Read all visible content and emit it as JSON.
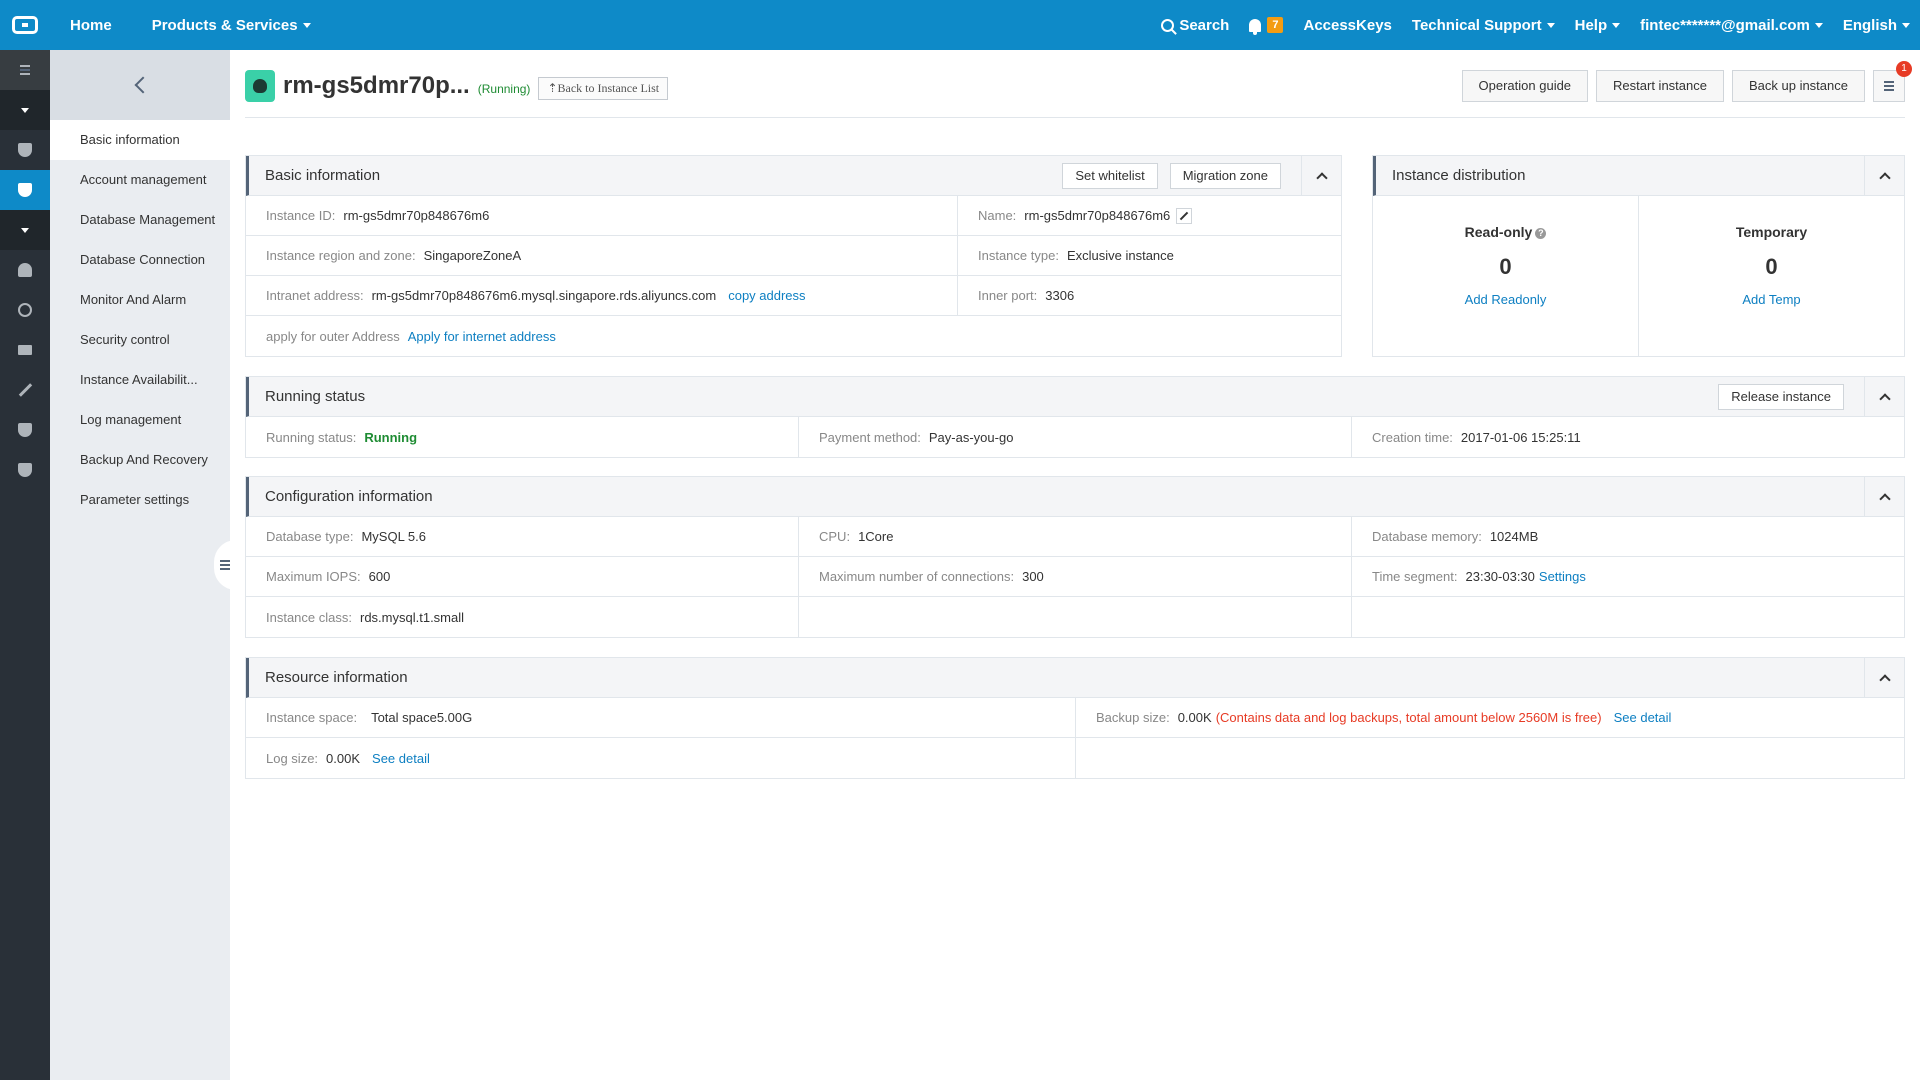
{
  "topbar": {
    "home": "Home",
    "products": "Products & Services",
    "search": "Search",
    "notifications_count": "7",
    "access_keys": "AccessKeys",
    "tech_support": "Technical Support",
    "help": "Help",
    "account": "fintec*******@gmail.com",
    "language": "English"
  },
  "sidebar": {
    "items": [
      {
        "label": "Basic information"
      },
      {
        "label": "Account management"
      },
      {
        "label": "Database Management"
      },
      {
        "label": "Database Connection"
      },
      {
        "label": "Monitor And Alarm"
      },
      {
        "label": "Security control"
      },
      {
        "label": "Instance Availabilit..."
      },
      {
        "label": "Log management"
      },
      {
        "label": "Backup And Recovery"
      },
      {
        "label": "Parameter settings"
      }
    ]
  },
  "header": {
    "title": "rm-gs5dmr70p...",
    "status": "(Running)",
    "back_link": "⇡Back to Instance List",
    "buttons": {
      "operation_guide": "Operation guide",
      "restart": "Restart instance",
      "backup": "Back up instance"
    },
    "list_badge": "1"
  },
  "basic": {
    "title": "Basic information",
    "set_whitelist": "Set whitelist",
    "migration_zone": "Migration zone",
    "instance_id_label": "Instance ID:",
    "instance_id": "rm-gs5dmr70p848676m6",
    "name_label": "Name:",
    "name": "rm-gs5dmr70p848676m6",
    "region_label": "Instance region and zone:",
    "region": "SingaporeZoneA",
    "type_label": "Instance type:",
    "type": "Exclusive instance",
    "intranet_label": "Intranet address:",
    "intranet": "rm-gs5dmr70p848676m6.mysql.singapore.rds.aliyuncs.com",
    "copy_address": "copy address",
    "port_label": "Inner port:",
    "port": "3306",
    "outer_label": "apply for outer Address",
    "outer_link": "Apply for internet address"
  },
  "distribution": {
    "title": "Instance distribution",
    "readonly_label": "Read-only",
    "readonly_count": "0",
    "readonly_link": "Add Readonly",
    "temp_label": "Temporary",
    "temp_count": "0",
    "temp_link": "Add Temp"
  },
  "running": {
    "title": "Running status",
    "release": "Release instance",
    "status_label": "Running status:",
    "status": "Running",
    "payment_label": "Payment method:",
    "payment": "Pay-as-you-go",
    "created_label": "Creation time:",
    "created": "2017-01-06 15:25:11"
  },
  "config": {
    "title": "Configuration information",
    "db_type_label": "Database type:",
    "db_type": "MySQL 5.6",
    "cpu_label": "CPU:",
    "cpu": "1Core",
    "memory_label": "Database memory:",
    "memory": "1024MB",
    "iops_label": "Maximum IOPS:",
    "iops": "600",
    "conn_label": "Maximum number of connections:",
    "conn": "300",
    "time_label": "Time segment:",
    "time": "23:30-03:30",
    "settings_link": "Settings",
    "class_label": "Instance class:",
    "class": "rds.mysql.t1.small"
  },
  "resource": {
    "title": "Resource information",
    "space_label": "Instance space:",
    "space": "Total space5.00G",
    "backup_label": "Backup size:",
    "backup": "0.00K",
    "backup_note": "(Contains data and log backups, total amount below 2560M is free)",
    "backup_link": "See detail",
    "log_label": "Log size:",
    "log": "0.00K",
    "log_link": "See detail"
  },
  "colors": {
    "topbar": "#0e8ac8",
    "rail": "#293038",
    "link": "#0d7fc2",
    "running": "#1e8c33",
    "warning": "#e73b25",
    "badge": "#f39c12"
  }
}
